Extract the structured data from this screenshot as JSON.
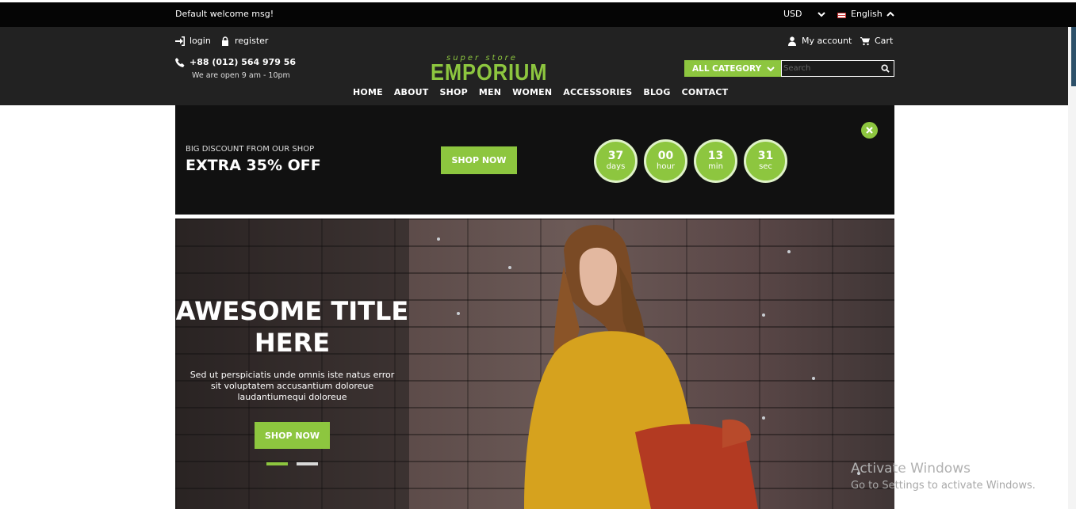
{
  "topbar": {
    "welcome": "Default welcome msg!",
    "currency": "USD",
    "language": "English"
  },
  "header": {
    "login": "login",
    "register": "register",
    "phone": "+88 (012) 564 979 56",
    "hours": "We are open 9 am - 10pm",
    "logo_tagline": "super store",
    "logo_name": "EMPORIUM",
    "my_account": "My account",
    "cart": "Cart",
    "category_label": "ALL CATEGORY",
    "search_placeholder": "Search"
  },
  "nav": {
    "items": [
      "HOME",
      "ABOUT",
      "SHOP",
      "MEN",
      "WOMEN",
      "ACCESSORIES",
      "BLOG",
      "CONTACT"
    ]
  },
  "promo": {
    "subtitle": "BIG DISCOUNT FROM OUR SHOP",
    "title": "EXTRA 35% OFF",
    "button": "SHOP NOW",
    "countdown": [
      {
        "value": "37",
        "unit": "days"
      },
      {
        "value": "00",
        "unit": "hour"
      },
      {
        "value": "13",
        "unit": "min"
      },
      {
        "value": "31",
        "unit": "sec"
      }
    ]
  },
  "hero": {
    "title_line1": "AWESOME TITLE",
    "title_line2": "HERE",
    "desc_line1": "Sed ut perspiciatis unde omnis iste natus error",
    "desc_line2": "sit voluptatem accusantium doloreue",
    "desc_line3": "laudantiumequi doloreue",
    "button": "SHOP NOW"
  },
  "watermark": {
    "line1": "Activate Windows",
    "line2": "Go to Settings to activate Windows."
  },
  "colors": {
    "accent": "#8dc63f",
    "header_bg": "#222222",
    "topbar_bg": "#050505"
  }
}
